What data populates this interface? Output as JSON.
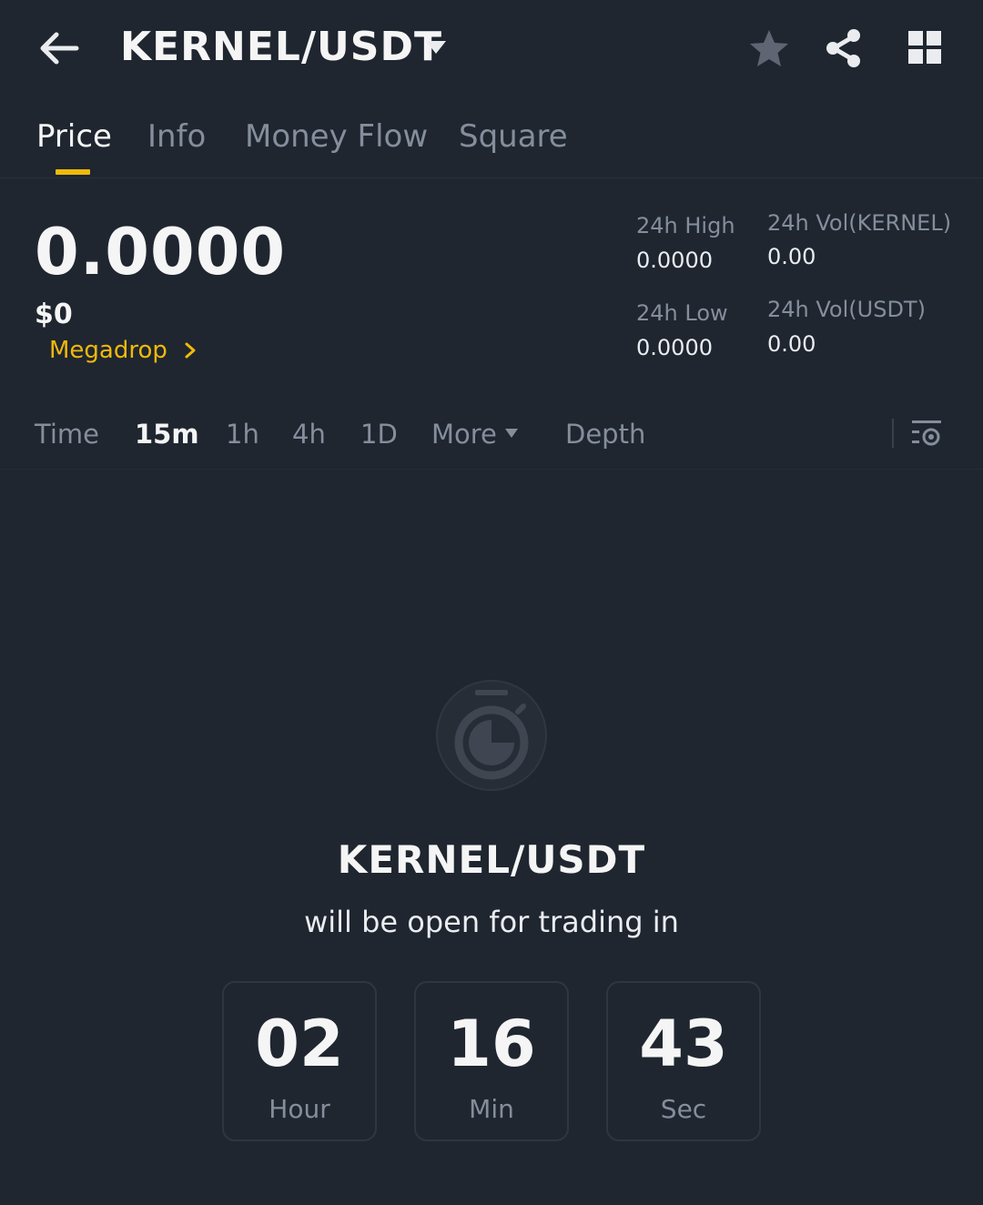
{
  "header": {
    "pair": "KERNEL/USDT"
  },
  "tabs": [
    {
      "label": "Price",
      "active": true
    },
    {
      "label": "Info",
      "active": false
    },
    {
      "label": "Money Flow",
      "active": false
    },
    {
      "label": "Square",
      "active": false
    }
  ],
  "price": {
    "last": "0.0000",
    "usd": "$0",
    "megadrop": "Megadrop"
  },
  "stats": {
    "high_label": "24h High",
    "high_value": "0.0000",
    "low_label": "24h Low",
    "low_value": "0.0000",
    "vol_base_label": "24h Vol(KERNEL)",
    "vol_base_value": "0.00",
    "vol_quote_label": "24h Vol(USDT)",
    "vol_quote_value": "0.00"
  },
  "intervals": [
    {
      "label": "Time",
      "active": false
    },
    {
      "label": "15m",
      "active": true
    },
    {
      "label": "1h",
      "active": false
    },
    {
      "label": "4h",
      "active": false
    },
    {
      "label": "1D",
      "active": false
    },
    {
      "label": "More",
      "active": false
    },
    {
      "label": "Depth",
      "active": false
    }
  ],
  "countdown": {
    "pair": "KERNEL/USDT",
    "message": "will be open for trading in",
    "hours": "02",
    "hours_label": "Hour",
    "minutes": "16",
    "minutes_label": "Min",
    "seconds": "43",
    "seconds_label": "Sec"
  },
  "colors": {
    "background": "#1f2630",
    "accent": "#f0b90b",
    "muted": "#848e9c"
  },
  "icons": [
    "back-arrow-icon",
    "caret-down-icon",
    "star-icon",
    "share-icon",
    "grid-icon",
    "chevron-right-icon",
    "chart-settings-icon",
    "timer-icon"
  ]
}
